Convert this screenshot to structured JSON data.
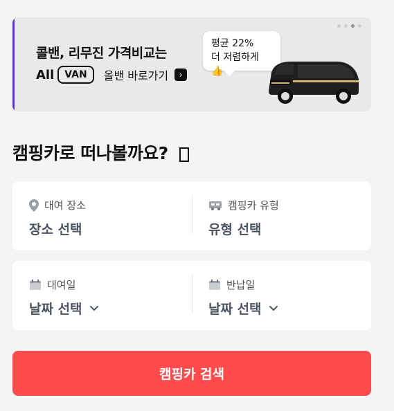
{
  "banner": {
    "headline": "콜밴, 리무진 가격비교는",
    "brand_all": "All",
    "brand_van": "VAN",
    "link_text": "올밴 바로가기",
    "bubble_line1": "평균 22%",
    "bubble_line2": "더 저렴하게 👍",
    "pagination_active_index": 3,
    "pagination_total": 4
  },
  "page_title": "캠핑카로 떠나볼까요?",
  "location_card": {
    "left_label": "대여 장소",
    "left_value": "장소 선택",
    "right_label": "캠핑카 유형",
    "right_value": "유형 선택"
  },
  "date_card": {
    "left_label": "대여일",
    "left_value": "날짜 선택",
    "right_label": "반납일",
    "right_value": "날짜 선택"
  },
  "search_button": "캠핑카 검색",
  "colors": {
    "accent": "#ff4b4b",
    "banner_accent": "#5b3cc4",
    "page_bg": "#f3f4f6"
  }
}
